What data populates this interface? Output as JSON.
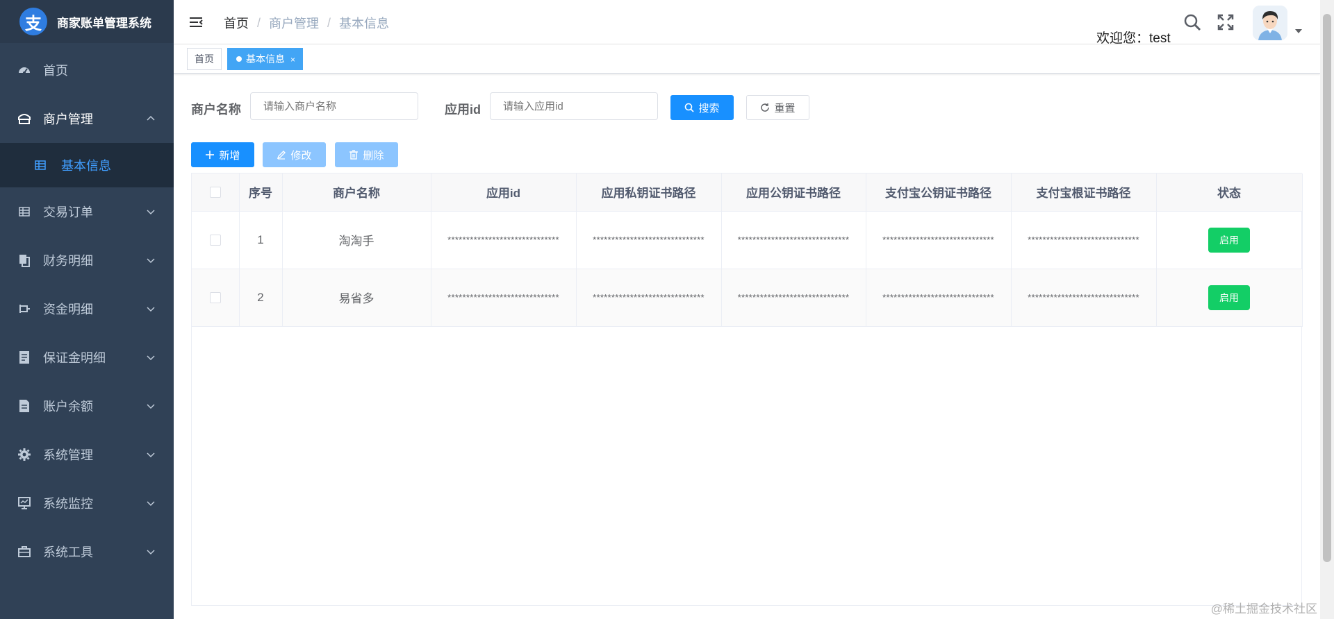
{
  "app": {
    "title": "商家账单管理系统",
    "logo_char": "支"
  },
  "sidebar": {
    "items": [
      {
        "label": "首页",
        "icon": "dashboard-icon"
      },
      {
        "label": "商户管理",
        "icon": "merchant-icon",
        "expanded": true,
        "children": [
          {
            "label": "基本信息",
            "icon": "table-icon",
            "active": true
          }
        ]
      },
      {
        "label": "交易订单",
        "icon": "table-icon"
      },
      {
        "label": "财务明细",
        "icon": "documents-icon"
      },
      {
        "label": "资金明细",
        "icon": "money-icon"
      },
      {
        "label": "保证金明细",
        "icon": "ledger-icon"
      },
      {
        "label": "账户余额",
        "icon": "document-icon"
      },
      {
        "label": "系统管理",
        "icon": "gear-icon"
      },
      {
        "label": "系统监控",
        "icon": "monitor-icon"
      },
      {
        "label": "系统工具",
        "icon": "toolbox-icon"
      }
    ]
  },
  "navbar": {
    "breadcrumb": [
      "首页",
      "商户管理",
      "基本信息"
    ],
    "breadcrumb_sep": "/",
    "welcome": "欢迎您：test"
  },
  "tags": [
    {
      "label": "首页",
      "active": false
    },
    {
      "label": "基本信息",
      "active": true,
      "close": "×"
    }
  ],
  "search": {
    "merchant_label": "商户名称",
    "merchant_placeholder": "请输入商户名称",
    "appid_label": "应用id",
    "appid_placeholder": "请输入应用id",
    "search_btn": "搜索",
    "reset_btn": "重置"
  },
  "toolbar": {
    "add": "新增",
    "edit": "修改",
    "delete": "删除"
  },
  "table": {
    "columns": [
      "序号",
      "商户名称",
      "应用id",
      "应用私钥证书路径",
      "应用公钥证书路径",
      "支付宝公钥证书路径",
      "支付宝根证书路径",
      "状态"
    ],
    "rows": [
      {
        "index": "1",
        "name": "淘淘手",
        "app_id": "******************************",
        "priv_path": "******************************",
        "pub_path": "******************************",
        "alipay_pub_path": "******************************",
        "alipay_root_path": "******************************",
        "status": "启用"
      },
      {
        "index": "2",
        "name": "易省多",
        "app_id": "******************************",
        "priv_path": "******************************",
        "pub_path": "******************************",
        "alipay_pub_path": "******************************",
        "alipay_root_path": "******************************",
        "status": "启用"
      }
    ]
  },
  "watermark": "@稀土掘金技术社区",
  "colors": {
    "sidebar_bg": "#304156",
    "primary": "#1890ff",
    "success": "#13ce66",
    "active_menu": "#409eff"
  }
}
